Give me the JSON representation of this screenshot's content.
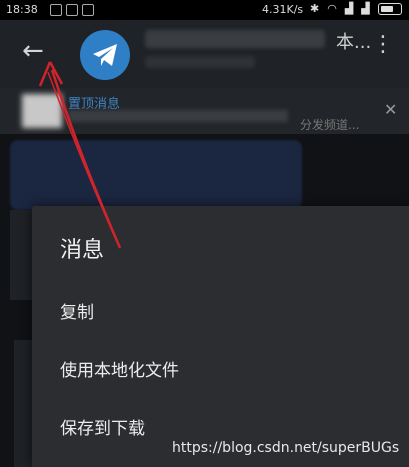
{
  "status_bar": {
    "time": "18:38",
    "network_speed": "4.31K/s",
    "icons": [
      "notification-icon",
      "notification-icon",
      "notification-icon",
      "bluetooth-icon",
      "wifi-icon",
      "signal-icon",
      "signal-icon",
      "battery-icon"
    ]
  },
  "app_bar": {
    "back_icon": "arrow-left-icon",
    "title_right": "本...",
    "menu_icon": "more-vertical-icon"
  },
  "pinned": {
    "label": "置顶消息",
    "text": "分发频道..."
  },
  "context_menu": {
    "title": "消息",
    "items": [
      {
        "label": "复制"
      },
      {
        "label": "使用本地化文件"
      },
      {
        "label": "保存到下载"
      }
    ]
  },
  "watermark": "https://blog.csdn.net/superBUGs",
  "colors": {
    "accent": "#3e86c8",
    "annotation_arrow": "#d0242c",
    "menu_bg": "#2b2d31",
    "app_bar_bg": "#1f2226"
  }
}
